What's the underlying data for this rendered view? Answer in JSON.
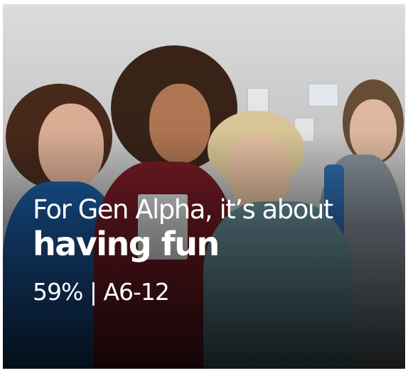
{
  "card": {
    "headline_line1": "For Gen Alpha, it’s about",
    "headline_line2": "having fun",
    "stat_text": "59% | A6-12"
  },
  "image": {
    "scene": "kids-group-photo"
  },
  "colors": {
    "text": "#ffffff",
    "backdrop_shadow": "#000000",
    "frame": "#ffffff"
  }
}
